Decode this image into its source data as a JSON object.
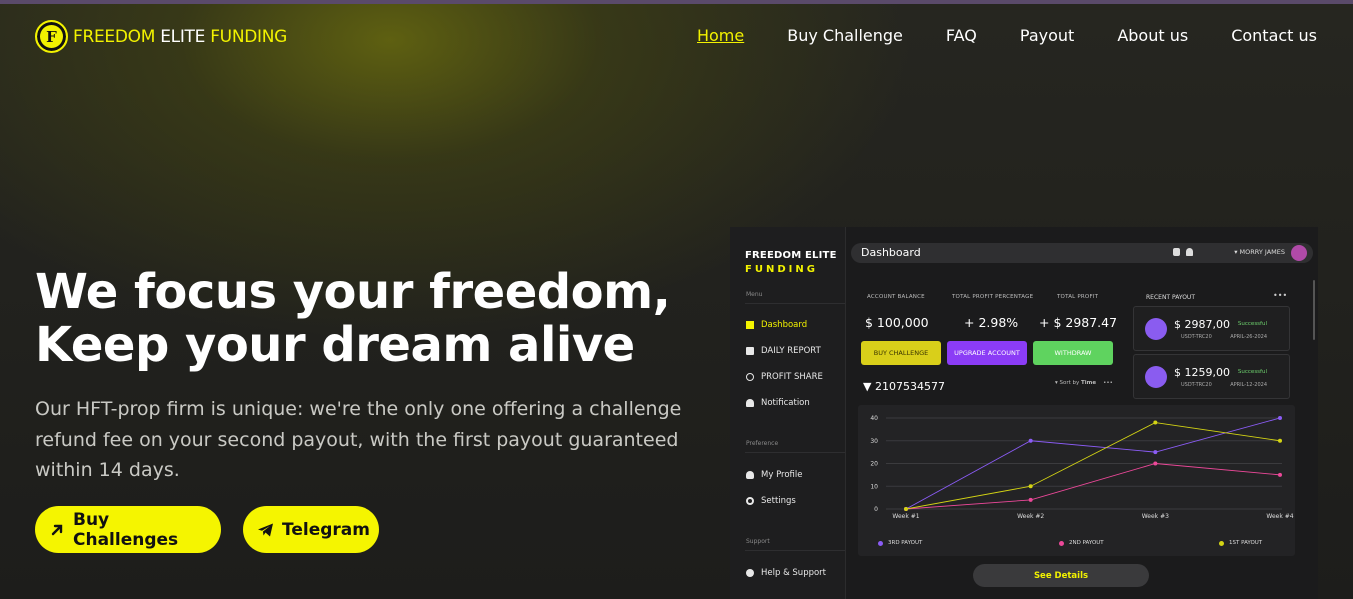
{
  "header": {
    "logo_mark": "F",
    "logo_part1": "FREEDOM",
    "logo_part2": "ELITE",
    "logo_part3": "FUNDING",
    "nav": [
      "Home",
      "Buy Challenge",
      "FAQ",
      "Payout",
      "About us",
      "Contact us"
    ]
  },
  "hero": {
    "title_line1": "We focus your freedom,",
    "title_line2": "Keep your dream alive",
    "subtitle": "Our HFT-prop firm is unique: we're the only one offering a challenge refund fee on your second payout, with the first payout guaranteed within 14 days.",
    "btn_buy": "Buy Challenges",
    "btn_telegram": "Telegram"
  },
  "dashboard": {
    "brand1": "FREEDOM ELITE",
    "brand2": "FUNDING",
    "title": "Dashboard",
    "user": "MORRY JAMES",
    "menu_label": "Menu",
    "preference_label": "Preference",
    "support_label": "Support",
    "menu": [
      "Dashboard",
      "DAILY REPORT",
      "PROFIT SHARE",
      "Notification"
    ],
    "pref": [
      "My Profile",
      "Settings"
    ],
    "support": [
      "Help & Support"
    ],
    "stats": [
      {
        "label": "ACCOUNT BALANCE",
        "value": "$ 100,000"
      },
      {
        "label": "TOTAL PROFIT PERCENTAGE",
        "value": "+ 2.98%"
      },
      {
        "label": "TOTAL PROFIT",
        "value": "+ $ 2987.47"
      }
    ],
    "actions": [
      "BUY CHALLENGE",
      "UPGRADE ACCOUNT",
      "WITHDRAW"
    ],
    "account_no": "2107534577",
    "sort_prefix": "Sort by",
    "sort_value": "Time",
    "recent_payout": "RECENT PAYOUT",
    "payouts": [
      {
        "amount": "$ 2987,00",
        "currency": "USDT-TRC20",
        "status": "Successful",
        "date": "APRIL-26-2024"
      },
      {
        "amount": "$ 1259,00",
        "currency": "USDT-TRC20",
        "status": "Successful",
        "date": "APRIL-12-2024"
      }
    ],
    "see_details": "See Details"
  },
  "chart_data": {
    "type": "line",
    "categories": [
      "Week #1",
      "Week #2",
      "Week #3",
      "Week #4"
    ],
    "ylim": [
      0,
      40
    ],
    "yticks": [
      0,
      10,
      20,
      30,
      40
    ],
    "series": [
      {
        "name": "3RD PAYOUT",
        "color": "#8b5cf6",
        "values": [
          0,
          30,
          25,
          40
        ]
      },
      {
        "name": "2ND PAYOUT",
        "color": "#ec4899",
        "values": [
          0,
          4,
          20,
          15
        ]
      },
      {
        "name": "1ST PAYOUT",
        "color": "#d4d414",
        "values": [
          0,
          10,
          38,
          30
        ]
      }
    ]
  },
  "colors": {
    "accent": "#f2f200",
    "upgrade": "#8b3cf6",
    "withdraw": "#5fd35f"
  }
}
